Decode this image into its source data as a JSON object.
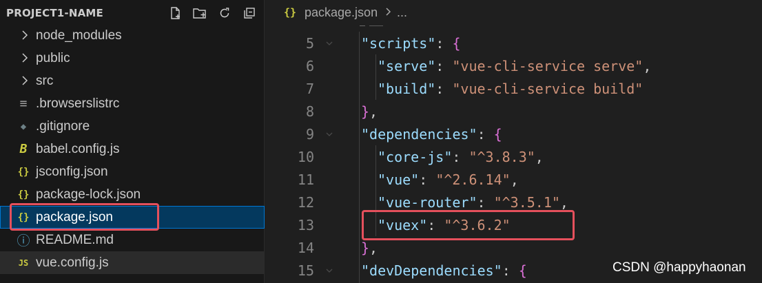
{
  "explorer": {
    "title": "PROJECT1-NAME",
    "actions": [
      {
        "name": "new-file-icon"
      },
      {
        "name": "new-folder-icon"
      },
      {
        "name": "refresh-icon"
      },
      {
        "name": "collapse-all-icon"
      }
    ],
    "items": [
      {
        "label": "node_modules",
        "type": "folder"
      },
      {
        "label": "public",
        "type": "folder"
      },
      {
        "label": "src",
        "type": "folder"
      },
      {
        "label": ".browserslistrc",
        "type": "file",
        "icon": "lines-icon",
        "glyph": "≡",
        "color": "#a0a0a0"
      },
      {
        "label": ".gitignore",
        "type": "file",
        "icon": "git-icon",
        "glyph": "◆",
        "color": "#6d8086"
      },
      {
        "label": "babel.config.js",
        "type": "file",
        "icon": "babel-icon",
        "glyph": "B",
        "color": "#cbcb41"
      },
      {
        "label": "jsconfig.json",
        "type": "file",
        "icon": "json-icon",
        "glyph": "{}",
        "color": "#cbcb41"
      },
      {
        "label": "package-lock.json",
        "type": "file",
        "icon": "json-icon",
        "glyph": "{}",
        "color": "#cbcb41"
      },
      {
        "label": "package.json",
        "type": "file",
        "icon": "json-icon",
        "glyph": "{}",
        "color": "#cbcb41",
        "selected": true
      },
      {
        "label": "README.md",
        "type": "file",
        "icon": "info-icon",
        "glyph": "ⓘ",
        "color": "#519aba"
      },
      {
        "label": "vue.config.js",
        "type": "file",
        "icon": "js-icon",
        "glyph": "JS",
        "color": "#cbcb41",
        "active": true
      }
    ]
  },
  "editor": {
    "breadcrumb": {
      "icon": "{}",
      "file": "package.json",
      "more": "..."
    },
    "lines": [
      {
        "n": "5",
        "fold": true,
        "indent": 0,
        "parts": [
          {
            "c": "k",
            "t": "\"scripts\""
          },
          {
            "c": "p",
            "t": ": "
          },
          {
            "c": "b1",
            "t": "{"
          }
        ]
      },
      {
        "n": "6",
        "fold": false,
        "indent": 1,
        "parts": [
          {
            "c": "k",
            "t": "\"serve\""
          },
          {
            "c": "p",
            "t": ": "
          },
          {
            "c": "s",
            "t": "\"vue-cli-service serve\""
          },
          {
            "c": "p",
            "t": ","
          }
        ]
      },
      {
        "n": "7",
        "fold": false,
        "indent": 1,
        "parts": [
          {
            "c": "k",
            "t": "\"build\""
          },
          {
            "c": "p",
            "t": ": "
          },
          {
            "c": "s",
            "t": "\"vue-cli-service build\""
          }
        ]
      },
      {
        "n": "8",
        "fold": false,
        "indent": 0,
        "parts": [
          {
            "c": "b1",
            "t": "}"
          },
          {
            "c": "p",
            "t": ","
          }
        ]
      },
      {
        "n": "9",
        "fold": true,
        "indent": 0,
        "parts": [
          {
            "c": "k",
            "t": "\"dependencies\""
          },
          {
            "c": "p",
            "t": ": "
          },
          {
            "c": "b1",
            "t": "{"
          }
        ]
      },
      {
        "n": "10",
        "fold": false,
        "indent": 1,
        "parts": [
          {
            "c": "k",
            "t": "\"core-js\""
          },
          {
            "c": "p",
            "t": ": "
          },
          {
            "c": "s",
            "t": "\"^3.8.3\""
          },
          {
            "c": "p",
            "t": ","
          }
        ]
      },
      {
        "n": "11",
        "fold": false,
        "indent": 1,
        "parts": [
          {
            "c": "k",
            "t": "\"vue\""
          },
          {
            "c": "p",
            "t": ": "
          },
          {
            "c": "s",
            "t": "\"^2.6.14\""
          },
          {
            "c": "p",
            "t": ","
          }
        ]
      },
      {
        "n": "12",
        "fold": false,
        "indent": 1,
        "parts": [
          {
            "c": "k",
            "t": "\"vue-router\""
          },
          {
            "c": "p",
            "t": ": "
          },
          {
            "c": "s",
            "t": "\"^3.5.1\""
          },
          {
            "c": "p",
            "t": ","
          }
        ]
      },
      {
        "n": "13",
        "fold": false,
        "indent": 1,
        "parts": [
          {
            "c": "k",
            "t": "\"vuex\""
          },
          {
            "c": "p",
            "t": ": "
          },
          {
            "c": "s",
            "t": "\"^3.6.2\""
          }
        ]
      },
      {
        "n": "14",
        "fold": false,
        "indent": 0,
        "parts": [
          {
            "c": "b1",
            "t": "}"
          },
          {
            "c": "p",
            "t": ","
          }
        ]
      },
      {
        "n": "15",
        "fold": true,
        "indent": 0,
        "parts": [
          {
            "c": "k",
            "t": "\"devDependencies\""
          },
          {
            "c": "p",
            "t": ": "
          },
          {
            "c": "b1",
            "t": "{"
          }
        ]
      }
    ]
  },
  "watermark": "CSDN @happyhaonan"
}
